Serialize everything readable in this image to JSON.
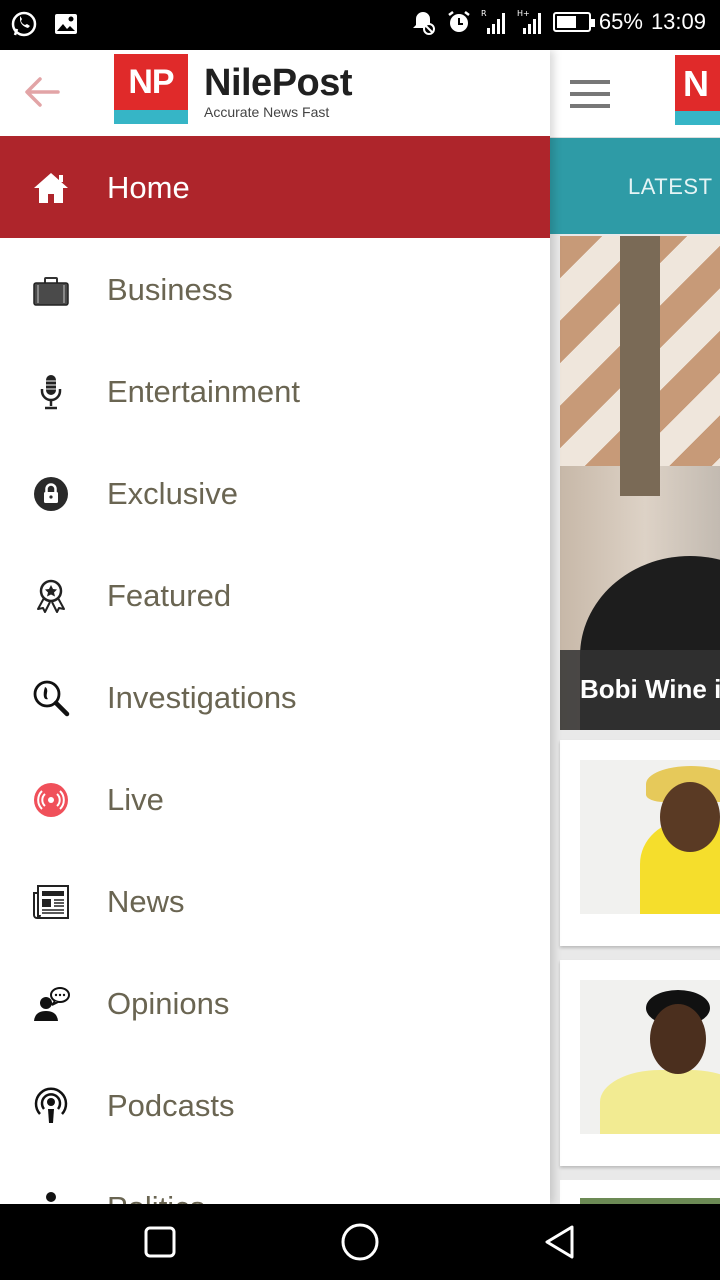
{
  "status_bar": {
    "battery_percent_text": "65%",
    "battery_level": 0.65,
    "time": "13:09",
    "left_icons": [
      "whatsapp-icon",
      "image-icon"
    ],
    "right_icons": [
      "notification-muted-icon",
      "alarm-icon",
      "signal-r-icon",
      "signal-h-plus-icon",
      "battery-icon"
    ]
  },
  "drawer": {
    "logo_mark": "NP",
    "logo_title": "NilePost",
    "logo_tagline": "Accurate News Fast",
    "items": [
      {
        "label": "Home",
        "icon": "home-icon",
        "active": true
      },
      {
        "label": "Business",
        "icon": "briefcase-icon",
        "active": false
      },
      {
        "label": "Entertainment",
        "icon": "microphone-icon",
        "active": false
      },
      {
        "label": "Exclusive",
        "icon": "lock-icon",
        "active": false
      },
      {
        "label": "Featured",
        "icon": "award-ribbon-icon",
        "active": false
      },
      {
        "label": "Investigations",
        "icon": "magnifier-footprint-icon",
        "active": false
      },
      {
        "label": "Live",
        "icon": "live-broadcast-icon",
        "active": false
      },
      {
        "label": "News",
        "icon": "newspaper-icon",
        "active": false
      },
      {
        "label": "Opinions",
        "icon": "person-speech-icon",
        "active": false
      },
      {
        "label": "Podcasts",
        "icon": "podcast-icon",
        "active": false
      },
      {
        "label": "Politics",
        "icon": "politics-icon",
        "active": false
      }
    ]
  },
  "background_app": {
    "tab_label": "LATEST",
    "featured_caption": "Bobi Wine i",
    "logo_peek": "N"
  },
  "colors": {
    "accent_red": "#ae252b",
    "logo_red": "#e02a2a",
    "logo_teal": "#36b5c6",
    "tab_teal": "#2e9ba6",
    "menu_text": "#6a6552"
  }
}
